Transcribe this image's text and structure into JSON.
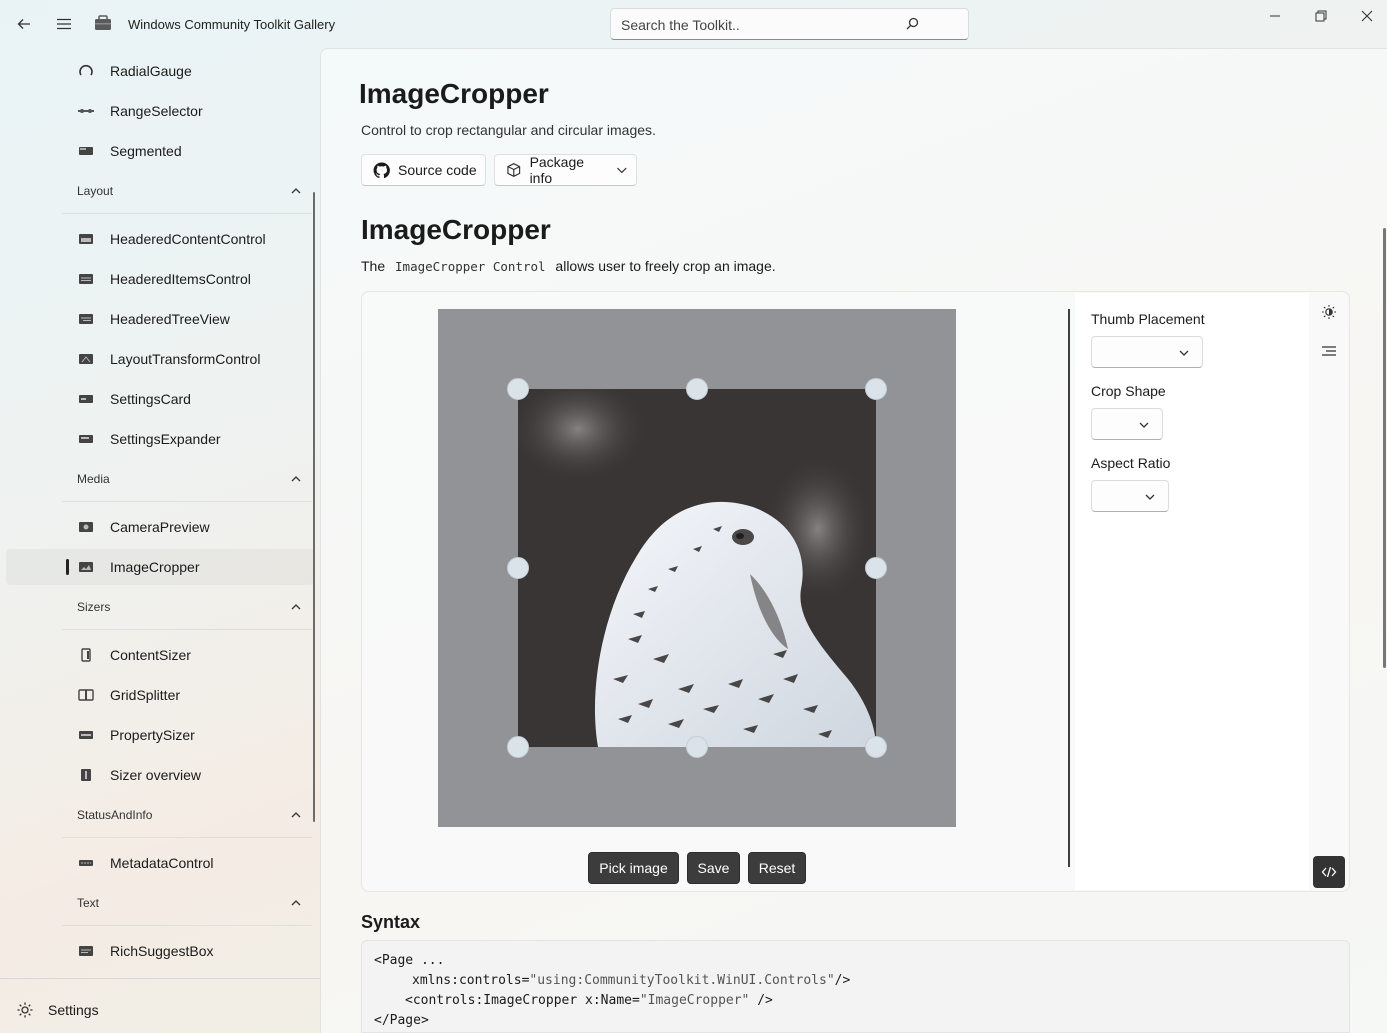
{
  "titlebar": {
    "app_title": "Windows Community Toolkit Gallery",
    "search_placeholder": "Search the Toolkit.."
  },
  "sidebar": {
    "items_top": [
      {
        "label": "RadialGauge",
        "icon": "radial-gauge-icon"
      },
      {
        "label": "RangeSelector",
        "icon": "range-selector-icon"
      },
      {
        "label": "Segmented",
        "icon": "segmented-icon"
      }
    ],
    "groups": [
      {
        "header": "Layout",
        "items": [
          "HeaderedContentControl",
          "HeaderedItemsControl",
          "HeaderedTreeView",
          "LayoutTransformControl",
          "SettingsCard",
          "SettingsExpander"
        ]
      },
      {
        "header": "Media",
        "items": [
          "CameraPreview",
          "ImageCropper"
        ]
      },
      {
        "header": "Sizers",
        "items": [
          "ContentSizer",
          "GridSplitter",
          "PropertySizer",
          "Sizer overview"
        ]
      },
      {
        "header": "StatusAndInfo",
        "items": [
          "MetadataControl"
        ]
      },
      {
        "header": "Text",
        "items": [
          "RichSuggestBox"
        ]
      }
    ],
    "selected_item": "ImageCropper",
    "settings_label": "Settings"
  },
  "page": {
    "title": "ImageCropper",
    "subtitle": "Control to crop rectangular and circular images.",
    "source_button": "Source code",
    "package_button": "Package info"
  },
  "section": {
    "title": "ImageCropper",
    "desc_before": "The",
    "desc_code": "ImageCropper Control",
    "desc_after": "allows user to freely crop an image."
  },
  "sample": {
    "actions": {
      "pick": "Pick image",
      "save": "Save",
      "reset": "Reset"
    },
    "options": {
      "thumb_placement_label": "Thumb Placement",
      "crop_shape_label": "Crop Shape",
      "aspect_ratio_label": "Aspect Ratio"
    }
  },
  "syntax": {
    "title": "Syntax",
    "line1": "<Page ...",
    "line2_a": "xmlns:controls=",
    "line2_b": "\"using:CommunityToolkit.WinUI.Controls\"",
    "line2_c": "/>",
    "line3_a": "<controls:ImageCropper x:Name=",
    "line3_b": "\"ImageCropper\"",
    "line3_c": " />",
    "line4": "</Page>"
  },
  "colors": {
    "accent_dark": "#3c3c3c",
    "crop_overlay": "#929397",
    "thumb_fill": "#dbe3ea"
  }
}
